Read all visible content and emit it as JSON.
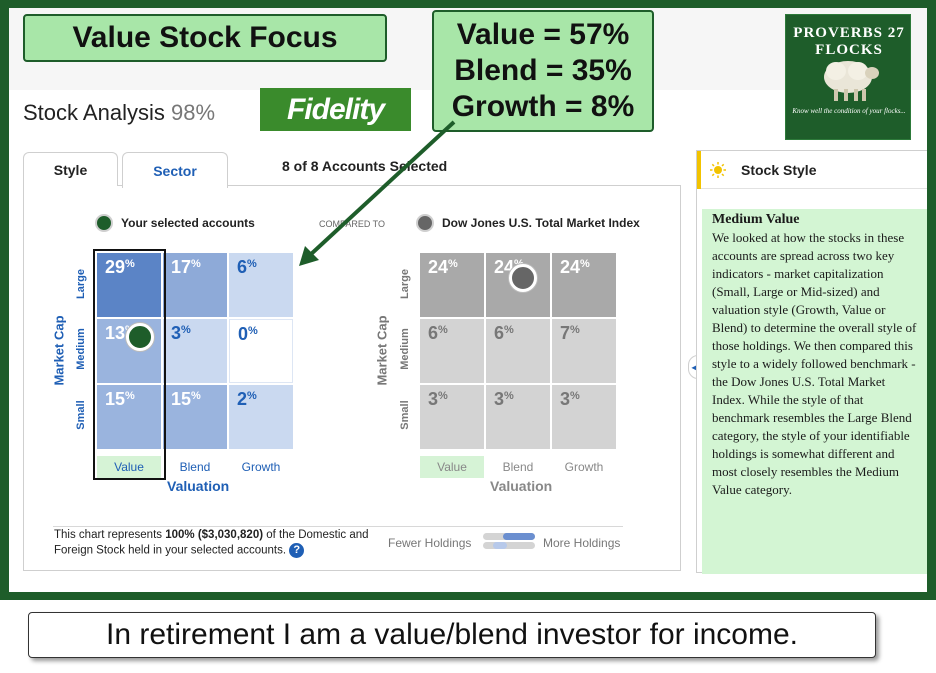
{
  "callouts": {
    "title": "Value Stock Focus",
    "breakdown": [
      "Value = 57%",
      "Blend = 35%",
      "Growth = 8%"
    ],
    "caption": "In retirement I am a value/blend investor for income."
  },
  "logo": {
    "name": "PROVERBS 27 FLOCKS",
    "tagline": "Know well the condition of your flocks..."
  },
  "header": {
    "label": "Stock Analysis",
    "percent": "98%",
    "brand": "Fidelity"
  },
  "tabs": [
    {
      "label": "Style",
      "active": true
    },
    {
      "label": "Sector",
      "active": false
    }
  ],
  "accounts_selected": "8 of 8 Accounts Selected",
  "legend": {
    "selected": "Your selected accounts",
    "compared": "COMPARED TO",
    "benchmark": "Dow Jones U.S. Total Market Index",
    "selected_color": "#1e5d2a",
    "benchmark_color": "#666666"
  },
  "grid_labels": {
    "rows": [
      "Large",
      "Medium",
      "Small"
    ],
    "cols": [
      "Value",
      "Blend",
      "Growth"
    ],
    "y_axis": "Market Cap",
    "x_axis": "Valuation"
  },
  "style_box": {
    "yours": [
      [
        "29",
        "17",
        "6"
      ],
      [
        "13",
        "3",
        "0"
      ],
      [
        "15",
        "15",
        "2"
      ]
    ],
    "benchmark": [
      [
        "24",
        "24",
        "24"
      ],
      [
        "6",
        "6",
        "7"
      ],
      [
        "3",
        "3",
        "3"
      ]
    ],
    "pct_symbol": "%"
  },
  "footnote": {
    "pre": "This chart represents ",
    "amount": "100% ($3,030,820)",
    "post": " of the Domestic and Foreign Stock held in your selected accounts.",
    "help": "?"
  },
  "holdings_scale": {
    "fewer": "Fewer Holdings",
    "more": "More Holdings"
  },
  "sidebar": {
    "title": "Stock Style",
    "heading": "Medium Value",
    "body": "We looked at how the stocks in these accounts are spread across two key indicators - market capitalization (Small, Large or Mid-sized) and valuation style (Growth, Value or Blend) to determine the overall style of those holdings. We then compared this style to a widely followed benchmark - the Dow Jones U.S. Total Market Index. While the style of that benchmark resembles the Large Blend category, the style of your identifiable holdings is somewhat different and most closely resembles the Medium Value category.",
    "toggle": "◀"
  },
  "colors": {
    "frame": "#1e5d2a",
    "callout": "#a8e6a8",
    "fidelity": "#3a8b2c",
    "link": "#1f5fb5"
  }
}
